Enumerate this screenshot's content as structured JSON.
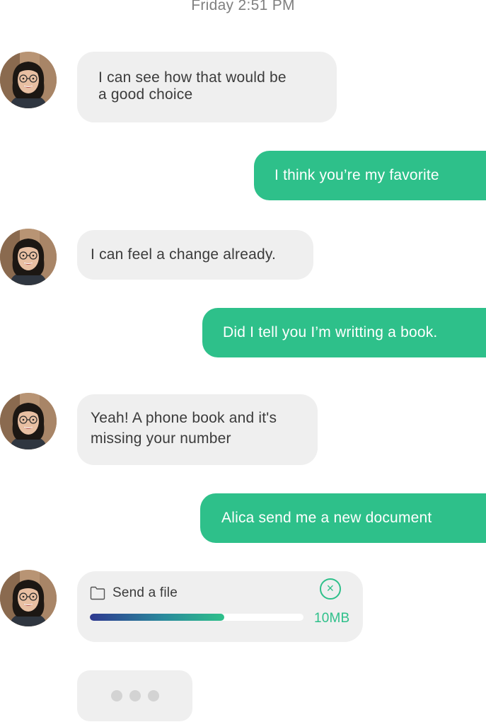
{
  "header": {
    "timestamp": "Friday 2:51 PM"
  },
  "messages": [
    {
      "from": "contact",
      "text_lines": [
        "I can see how that would be",
        "a good choice"
      ]
    },
    {
      "from": "me",
      "text": "I think you’re my favorite"
    },
    {
      "from": "contact",
      "text": "I can feel a change already."
    },
    {
      "from": "me",
      "text": "Did I tell you I’m writting a book."
    },
    {
      "from": "contact",
      "text_lines": [
        "Yeah! A phone book and it's",
        "missing your number"
      ]
    },
    {
      "from": "me",
      "text": "Alica send me a new document"
    }
  ],
  "file_transfer": {
    "label": "Send a file",
    "size": "10MB",
    "progress_percent": 63,
    "cancel_icon": "close-circle-icon",
    "folder_icon": "folder-icon"
  },
  "typing_indicator": {
    "dots": 3
  },
  "colors": {
    "outgoing_bubble": "#2ec08a",
    "incoming_bubble": "#efefef",
    "accent": "#2ec08a",
    "progress_start": "#2e3990"
  }
}
